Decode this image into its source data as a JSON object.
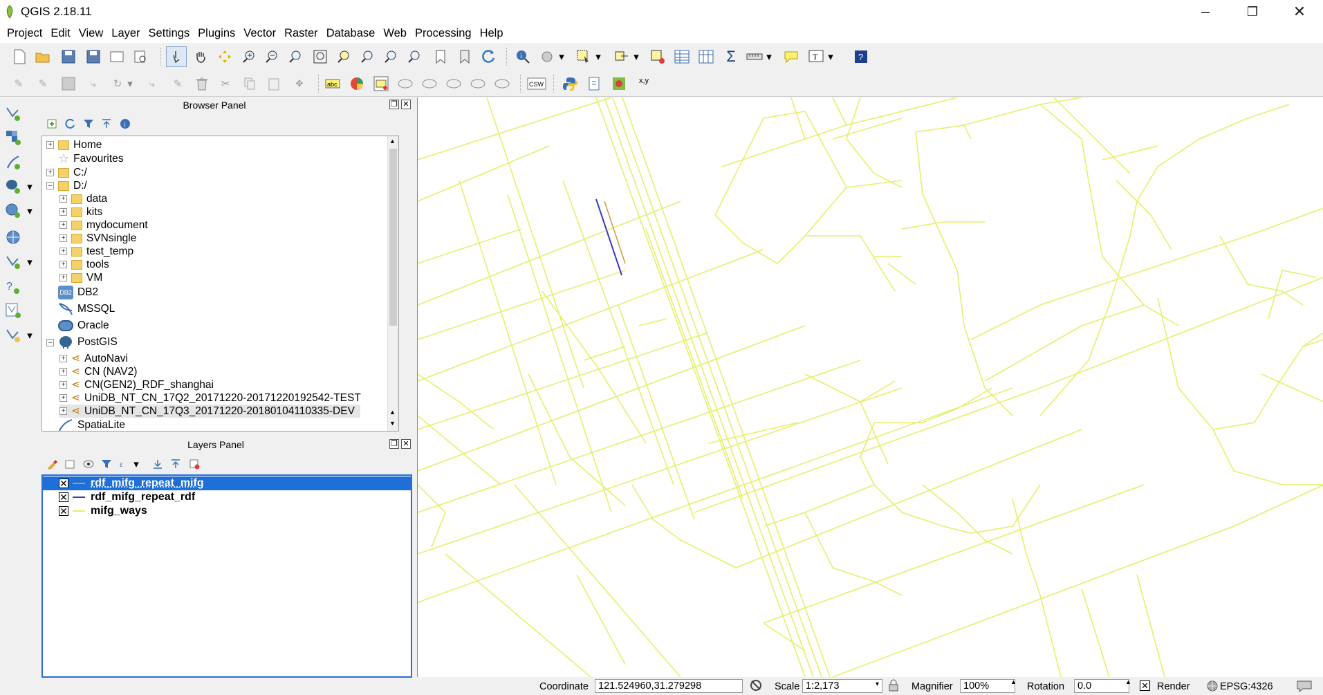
{
  "app": {
    "title": "QGIS 2.18.11"
  },
  "menu": [
    "Project",
    "Edit",
    "View",
    "Layer",
    "Settings",
    "Plugins",
    "Vector",
    "Raster",
    "Database",
    "Web",
    "Processing",
    "Help"
  ],
  "browser": {
    "title": "Browser Panel",
    "items": [
      {
        "label": "Home"
      },
      {
        "label": "Favourites"
      },
      {
        "label": "C:/"
      },
      {
        "label": "D:/"
      },
      {
        "label": "data"
      },
      {
        "label": "kits"
      },
      {
        "label": "mydocument"
      },
      {
        "label": "SVNsingle"
      },
      {
        "label": "test_temp"
      },
      {
        "label": "tools"
      },
      {
        "label": "VM"
      },
      {
        "label": "DB2"
      },
      {
        "label": "MSSQL"
      },
      {
        "label": "Oracle"
      },
      {
        "label": "PostGIS"
      },
      {
        "label": "AutoNavi"
      },
      {
        "label": "CN (NAV2)"
      },
      {
        "label": "CN(GEN2)_RDF_shanghai"
      },
      {
        "label": "UniDB_NT_CN_17Q2_20171220-20171220192542-TEST"
      },
      {
        "label": "UniDB_NT_CN_17Q3_20171220-20180104110335-DEV"
      },
      {
        "label": "SpatiaLite"
      }
    ],
    "db2_badge": "DB2"
  },
  "layers": {
    "title": "Layers Panel",
    "items": [
      {
        "name": "rdf_mifg_repeat_mifg",
        "checked": "✕",
        "color": "#c89b3c",
        "selected": true
      },
      {
        "name": "rdf_mifg_repeat_rdf",
        "checked": "✕",
        "color": "#3a3ab8"
      },
      {
        "name": "mifg_ways",
        "checked": "✕",
        "color": "#e6ef6a"
      }
    ]
  },
  "toolbar": {
    "xy_label": "x,y",
    "csw_label": "CSW"
  },
  "status": {
    "coordinate_label": "Coordinate",
    "coordinate_value": "121.524960,31.279298",
    "scale_label": "Scale",
    "scale_value": "1:2,173",
    "magnifier_label": "Magnifier",
    "magnifier_value": "100%",
    "rotation_label": "Rotation",
    "rotation_value": "0.0",
    "render_label": "Render",
    "render_checked": "✕",
    "crs_value": "EPSG:4326"
  },
  "colors": {
    "road": "#e6ef6a",
    "selection": "#2a6fd1",
    "mifg": "#c89b3c",
    "rdf": "#3a3ab8"
  }
}
